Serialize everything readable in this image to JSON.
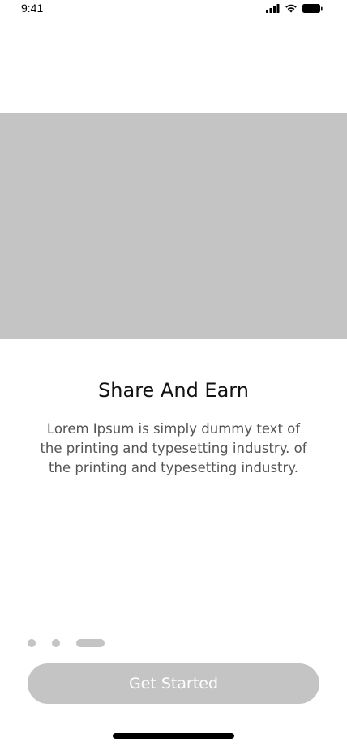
{
  "status_bar": {
    "time": "9:41",
    "icons": [
      "cellular-signal-icon",
      "wifi-icon",
      "battery-icon"
    ]
  },
  "onboarding": {
    "title": "Share And Earn",
    "description": "Lorem Ipsum is simply dummy text of the printing and typesetting industry. of the printing and typesetting industry.",
    "page_indicator": {
      "total": 3,
      "active_index": 2
    },
    "cta_label": "Get Started"
  },
  "colors": {
    "placeholder": "#c4c4c4",
    "text_primary": "#111111",
    "text_secondary": "#555555",
    "button_text": "#ffffff"
  }
}
